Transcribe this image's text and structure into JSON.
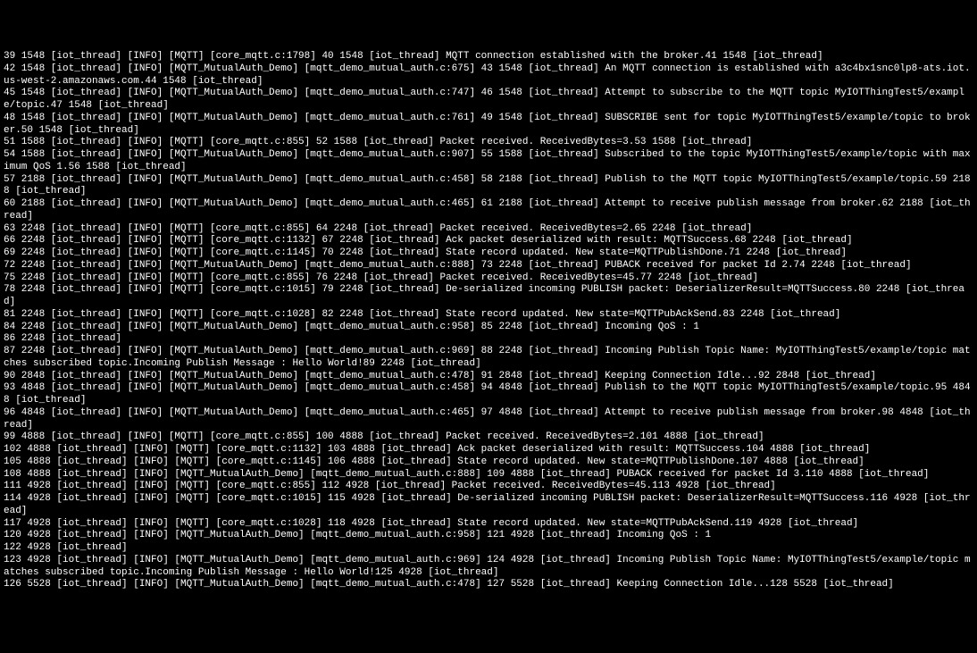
{
  "terminal": {
    "lines": [
      "39 1548 [iot_thread] [INFO] [MQTT] [core_mqtt.c:1798] 40 1548 [iot_thread] MQTT connection established with the broker.41 1548 [iot_thread]",
      "42 1548 [iot_thread] [INFO] [MQTT_MutualAuth_Demo] [mqtt_demo_mutual_auth.c:675] 43 1548 [iot_thread] An MQTT connection is established with a3c4bx1snc0lp8-ats.iot.us-west-2.amazonaws.com.44 1548 [iot_thread]",
      "45 1548 [iot_thread] [INFO] [MQTT_MutualAuth_Demo] [mqtt_demo_mutual_auth.c:747] 46 1548 [iot_thread] Attempt to subscribe to the MQTT topic MyIOTThingTest5/example/topic.47 1548 [iot_thread]",
      "48 1548 [iot_thread] [INFO] [MQTT_MutualAuth_Demo] [mqtt_demo_mutual_auth.c:761] 49 1548 [iot_thread] SUBSCRIBE sent for topic MyIOTThingTest5/example/topic to broker.50 1548 [iot_thread]",
      "51 1588 [iot_thread] [INFO] [MQTT] [core_mqtt.c:855] 52 1588 [iot_thread] Packet received. ReceivedBytes=3.53 1588 [iot_thread]",
      "54 1588 [iot_thread] [INFO] [MQTT_MutualAuth_Demo] [mqtt_demo_mutual_auth.c:907] 55 1588 [iot_thread] Subscribed to the topic MyIOTThingTest5/example/topic with maximum QoS 1.56 1588 [iot_thread]",
      "57 2188 [iot_thread] [INFO] [MQTT_MutualAuth_Demo] [mqtt_demo_mutual_auth.c:458] 58 2188 [iot_thread] Publish to the MQTT topic MyIOTThingTest5/example/topic.59 2188 [iot_thread]",
      "60 2188 [iot_thread] [INFO] [MQTT_MutualAuth_Demo] [mqtt_demo_mutual_auth.c:465] 61 2188 [iot_thread] Attempt to receive publish message from broker.62 2188 [iot_thread]",
      "63 2248 [iot_thread] [INFO] [MQTT] [core_mqtt.c:855] 64 2248 [iot_thread] Packet received. ReceivedBytes=2.65 2248 [iot_thread]",
      "66 2248 [iot_thread] [INFO] [MQTT] [core_mqtt.c:1132] 67 2248 [iot_thread] Ack packet deserialized with result: MQTTSuccess.68 2248 [iot_thread]",
      "69 2248 [iot_thread] [INFO] [MQTT] [core_mqtt.c:1145] 70 2248 [iot_thread] State record updated. New state=MQTTPublishDone.71 2248 [iot_thread]",
      "72 2248 [iot_thread] [INFO] [MQTT_MutualAuth_Demo] [mqtt_demo_mutual_auth.c:888] 73 2248 [iot_thread] PUBACK received for packet Id 2.74 2248 [iot_thread]",
      "75 2248 [iot_thread] [INFO] [MQTT] [core_mqtt.c:855] 76 2248 [iot_thread] Packet received. ReceivedBytes=45.77 2248 [iot_thread]",
      "78 2248 [iot_thread] [INFO] [MQTT] [core_mqtt.c:1015] 79 2248 [iot_thread] De-serialized incoming PUBLISH packet: DeserializerResult=MQTTSuccess.80 2248 [iot_thread]",
      "81 2248 [iot_thread] [INFO] [MQTT] [core_mqtt.c:1028] 82 2248 [iot_thread] State record updated. New state=MQTTPubAckSend.83 2248 [iot_thread]",
      "84 2248 [iot_thread] [INFO] [MQTT_MutualAuth_Demo] [mqtt_demo_mutual_auth.c:958] 85 2248 [iot_thread] Incoming QoS : 1",
      "86 2248 [iot_thread]",
      "87 2248 [iot_thread] [INFO] [MQTT_MutualAuth_Demo] [mqtt_demo_mutual_auth.c:969] 88 2248 [iot_thread] Incoming Publish Topic Name: MyIOTThingTest5/example/topic matches subscribed topic.Incoming Publish Message : Hello World!89 2248 [iot_thread]",
      "90 2848 [iot_thread] [INFO] [MQTT_MutualAuth_Demo] [mqtt_demo_mutual_auth.c:478] 91 2848 [iot_thread] Keeping Connection Idle...92 2848 [iot_thread]",
      "93 4848 [iot_thread] [INFO] [MQTT_MutualAuth_Demo] [mqtt_demo_mutual_auth.c:458] 94 4848 [iot_thread] Publish to the MQTT topic MyIOTThingTest5/example/topic.95 4848 [iot_thread]",
      "96 4848 [iot_thread] [INFO] [MQTT_MutualAuth_Demo] [mqtt_demo_mutual_auth.c:465] 97 4848 [iot_thread] Attempt to receive publish message from broker.98 4848 [iot_thread]",
      "99 4888 [iot_thread] [INFO] [MQTT] [core_mqtt.c:855] 100 4888 [iot_thread] Packet received. ReceivedBytes=2.101 4888 [iot_thread]",
      "102 4888 [iot_thread] [INFO] [MQTT] [core_mqtt.c:1132] 103 4888 [iot_thread] Ack packet deserialized with result: MQTTSuccess.104 4888 [iot_thread]",
      "105 4888 [iot_thread] [INFO] [MQTT] [core_mqtt.c:1145] 106 4888 [iot_thread] State record updated. New state=MQTTPublishDone.107 4888 [iot_thread]",
      "108 4888 [iot_thread] [INFO] [MQTT_MutualAuth_Demo] [mqtt_demo_mutual_auth.c:888] 109 4888 [iot_thread] PUBACK received for packet Id 3.110 4888 [iot_thread]",
      "111 4928 [iot_thread] [INFO] [MQTT] [core_mqtt.c:855] 112 4928 [iot_thread] Packet received. ReceivedBytes=45.113 4928 [iot_thread]",
      "114 4928 [iot_thread] [INFO] [MQTT] [core_mqtt.c:1015] 115 4928 [iot_thread] De-serialized incoming PUBLISH packet: DeserializerResult=MQTTSuccess.116 4928 [iot_thread]",
      "117 4928 [iot_thread] [INFO] [MQTT] [core_mqtt.c:1028] 118 4928 [iot_thread] State record updated. New state=MQTTPubAckSend.119 4928 [iot_thread]",
      "120 4928 [iot_thread] [INFO] [MQTT_MutualAuth_Demo] [mqtt_demo_mutual_auth.c:958] 121 4928 [iot_thread] Incoming QoS : 1",
      "122 4928 [iot_thread]",
      "123 4928 [iot_thread] [INFO] [MQTT_MutualAuth_Demo] [mqtt_demo_mutual_auth.c:969] 124 4928 [iot_thread] Incoming Publish Topic Name: MyIOTThingTest5/example/topic matches subscribed topic.Incoming Publish Message : Hello World!125 4928 [iot_thread]",
      "126 5528 [iot_thread] [INFO] [MQTT_MutualAuth_Demo] [mqtt_demo_mutual_auth.c:478] 127 5528 [iot_thread] Keeping Connection Idle...128 5528 [iot_thread]"
    ]
  }
}
